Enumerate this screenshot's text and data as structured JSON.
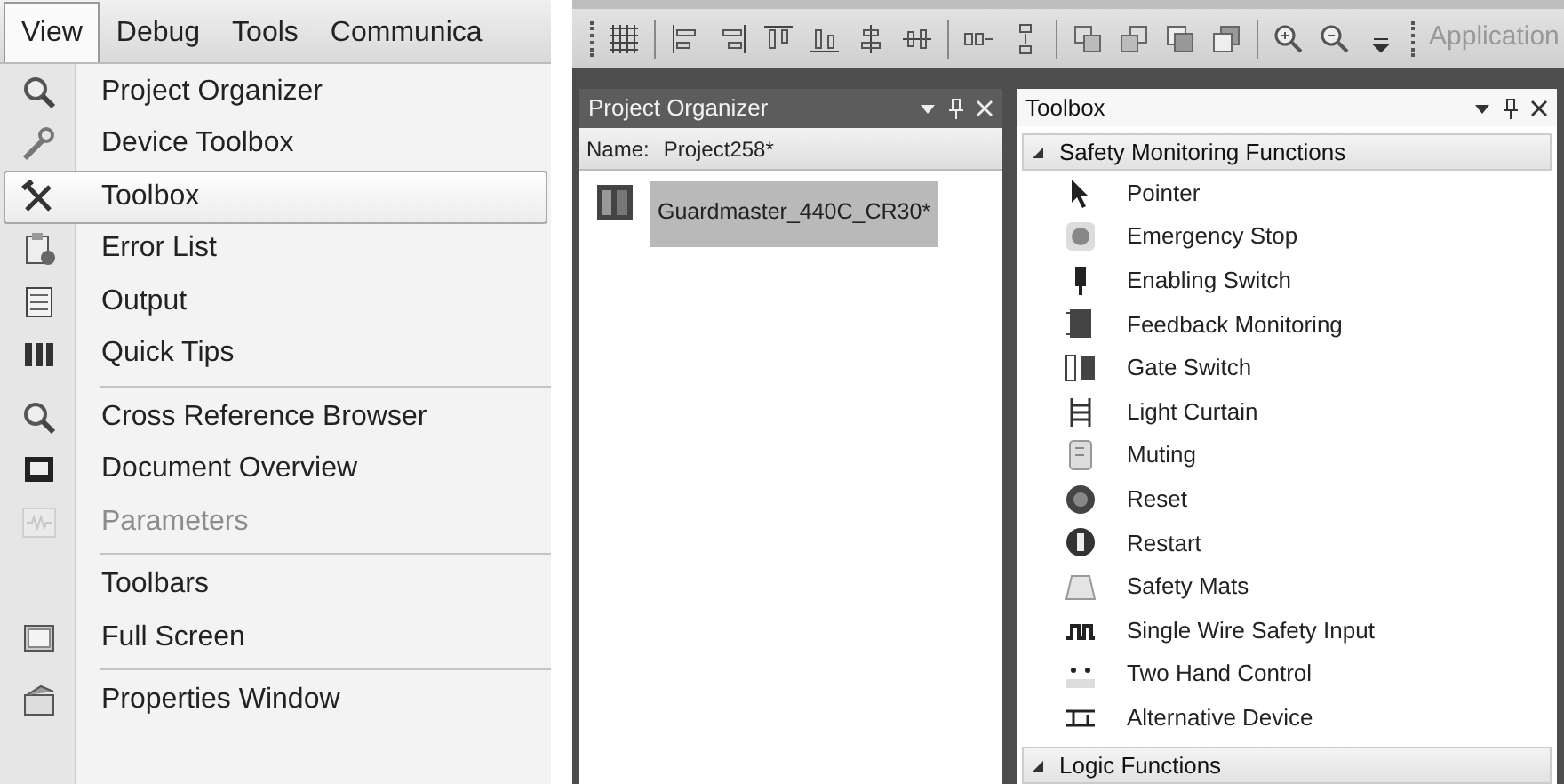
{
  "view_menu": {
    "menu_bar": [
      {
        "label": "View",
        "selected": true
      },
      {
        "label": "Debug",
        "selected": false
      },
      {
        "label": "Tools",
        "selected": false
      },
      {
        "label": "Communica",
        "selected": false
      }
    ],
    "groups": [
      [
        {
          "label": "Project Organizer",
          "selected": false,
          "disabled": false
        },
        {
          "label": "Device Toolbox",
          "selected": false,
          "disabled": false
        },
        {
          "label": "Toolbox",
          "selected": true,
          "disabled": false
        },
        {
          "label": "Error List",
          "selected": false,
          "disabled": false
        },
        {
          "label": "Output",
          "selected": false,
          "disabled": false
        },
        {
          "label": "Quick Tips",
          "selected": false,
          "disabled": false
        }
      ],
      [
        {
          "label": "Cross Reference Browser",
          "selected": false,
          "disabled": false
        },
        {
          "label": "Document Overview",
          "selected": false,
          "disabled": false
        },
        {
          "label": "Parameters",
          "selected": false,
          "disabled": true
        }
      ],
      [
        {
          "label": "Toolbars",
          "selected": false,
          "disabled": false
        },
        {
          "label": "Full Screen",
          "selected": false,
          "disabled": false
        }
      ],
      [
        {
          "label": "Properties Window",
          "selected": false,
          "disabled": false
        }
      ]
    ]
  },
  "ide": {
    "toolbar": {
      "overflow_label": "Application"
    },
    "project_organizer": {
      "title": "Project Organizer",
      "active": false,
      "name_label": "Name:",
      "name_value": "Project258*",
      "tree": [
        {
          "label": "Guardmaster_440C_CR30*",
          "selected": true
        }
      ]
    },
    "toolbox": {
      "title": "Toolbox",
      "active": true,
      "groups": [
        {
          "label": "Safety Monitoring Functions",
          "expanded": true,
          "items": [
            "Pointer",
            "Emergency Stop",
            "Enabling Switch",
            "Feedback Monitoring",
            "Gate Switch",
            "Light Curtain",
            "Muting",
            "Reset",
            "Restart",
            "Safety Mats",
            "Single Wire Safety Input",
            "Two Hand Control",
            "Alternative Device"
          ]
        },
        {
          "label": "Logic Functions",
          "expanded": true
        }
      ]
    }
  }
}
